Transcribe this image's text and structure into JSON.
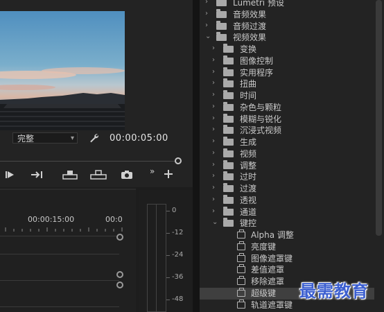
{
  "monitor": {
    "resolution": "完整",
    "timecode": "00:00:05:00",
    "icons": [
      "wrench-icon",
      "step-forward-icon",
      "go-to-out-icon",
      "lift-icon",
      "extract-icon",
      "camera-icon",
      "more-icon",
      "add-icon"
    ]
  },
  "timeline": {
    "ticks": [
      "00:00:15:00",
      "00:0"
    ]
  },
  "audio_meter": {
    "db_labels": [
      "0",
      "-12",
      "-24",
      "-36",
      "-48"
    ]
  },
  "effects": {
    "rows": [
      {
        "level": 1,
        "label": "Lumetri 预设",
        "expanded": false,
        "icon": "folder"
      },
      {
        "level": 1,
        "label": "音频效果",
        "expanded": false,
        "icon": "folder"
      },
      {
        "level": 1,
        "label": "音频过渡",
        "expanded": false,
        "icon": "folder"
      },
      {
        "level": 1,
        "label": "视频效果",
        "expanded": true,
        "icon": "folder"
      },
      {
        "level": 2,
        "label": "变换",
        "expanded": false,
        "icon": "folder"
      },
      {
        "level": 2,
        "label": "图像控制",
        "expanded": false,
        "icon": "folder"
      },
      {
        "level": 2,
        "label": "实用程序",
        "expanded": false,
        "icon": "folder"
      },
      {
        "level": 2,
        "label": "扭曲",
        "expanded": false,
        "icon": "folder"
      },
      {
        "level": 2,
        "label": "时间",
        "expanded": false,
        "icon": "folder"
      },
      {
        "level": 2,
        "label": "杂色与颗粒",
        "expanded": false,
        "icon": "folder"
      },
      {
        "level": 2,
        "label": "模糊与锐化",
        "expanded": false,
        "icon": "folder"
      },
      {
        "level": 2,
        "label": "沉浸式视频",
        "expanded": false,
        "icon": "folder"
      },
      {
        "level": 2,
        "label": "生成",
        "expanded": false,
        "icon": "folder"
      },
      {
        "level": 2,
        "label": "视频",
        "expanded": false,
        "icon": "folder"
      },
      {
        "level": 2,
        "label": "调整",
        "expanded": false,
        "icon": "folder"
      },
      {
        "level": 2,
        "label": "过时",
        "expanded": false,
        "icon": "folder"
      },
      {
        "level": 2,
        "label": "过渡",
        "expanded": false,
        "icon": "folder"
      },
      {
        "level": 2,
        "label": "透视",
        "expanded": false,
        "icon": "folder"
      },
      {
        "level": 2,
        "label": "通道",
        "expanded": false,
        "icon": "folder"
      },
      {
        "level": 2,
        "label": "键控",
        "expanded": true,
        "icon": "folder"
      },
      {
        "level": 3,
        "label": "Alpha 调整",
        "icon": "effect"
      },
      {
        "level": 3,
        "label": "亮度键",
        "icon": "effect"
      },
      {
        "level": 3,
        "label": "图像遮罩键",
        "icon": "effect"
      },
      {
        "level": 3,
        "label": "差值遮罩",
        "icon": "effect"
      },
      {
        "level": 3,
        "label": "移除遮罩",
        "icon": "effect"
      },
      {
        "level": 3,
        "label": "超级键",
        "icon": "effect",
        "selected": true
      },
      {
        "level": 3,
        "label": "轨道遮罩键",
        "icon": "effect"
      }
    ]
  },
  "watermark": "最需教育"
}
